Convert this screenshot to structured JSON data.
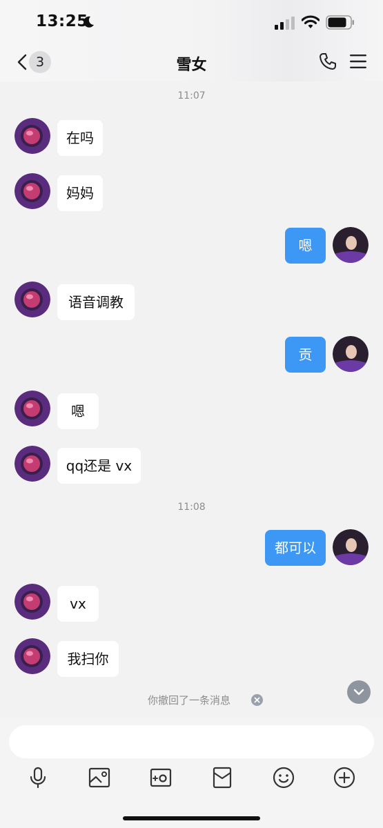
{
  "status_bar": {
    "time": "13:25"
  },
  "header": {
    "back_badge": "3",
    "title": "雪女"
  },
  "messages": [
    {
      "type": "time",
      "text": "11:07"
    },
    {
      "side": "in",
      "text": "在吗"
    },
    {
      "side": "in",
      "text": "妈妈"
    },
    {
      "side": "out",
      "text": "嗯"
    },
    {
      "side": "in",
      "text": "语音调教"
    },
    {
      "side": "out",
      "text": "贡"
    },
    {
      "side": "in",
      "text": "嗯"
    },
    {
      "side": "in",
      "text": "qq还是 vx"
    },
    {
      "type": "time",
      "text": "11:08"
    },
    {
      "side": "out",
      "text": "都可以"
    },
    {
      "side": "in",
      "text": "vx"
    },
    {
      "side": "in",
      "text": "我扫你"
    }
  ],
  "recall_notice": "你撤回了一条消息",
  "input": {
    "value": "",
    "placeholder": ""
  },
  "toolbar": [
    "microphone-icon",
    "image-icon",
    "camera-icon",
    "red-packet-icon",
    "emoji-icon",
    "plus-icon"
  ],
  "colors": {
    "out_bubble": "#3d97f5",
    "in_bubble": "#ffffff",
    "background": "#f2f2f3"
  }
}
